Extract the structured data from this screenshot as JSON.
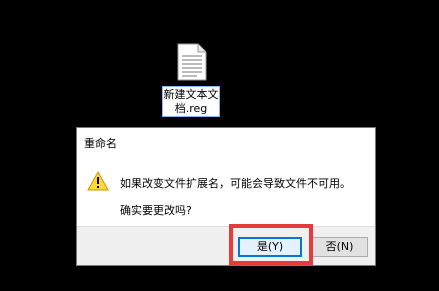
{
  "desktop": {
    "file": {
      "label": "新建文本文档.reg",
      "icon": "text-file-icon"
    }
  },
  "dialog": {
    "title": "重命名",
    "icon": "warning-icon",
    "message": "如果改变文件扩展名，可能会导致文件不可用。",
    "question": "确实要更改吗?",
    "buttons": {
      "yes": "是(Y)",
      "no": "否(N)"
    }
  },
  "highlight": {
    "color": "#e43c3c"
  }
}
